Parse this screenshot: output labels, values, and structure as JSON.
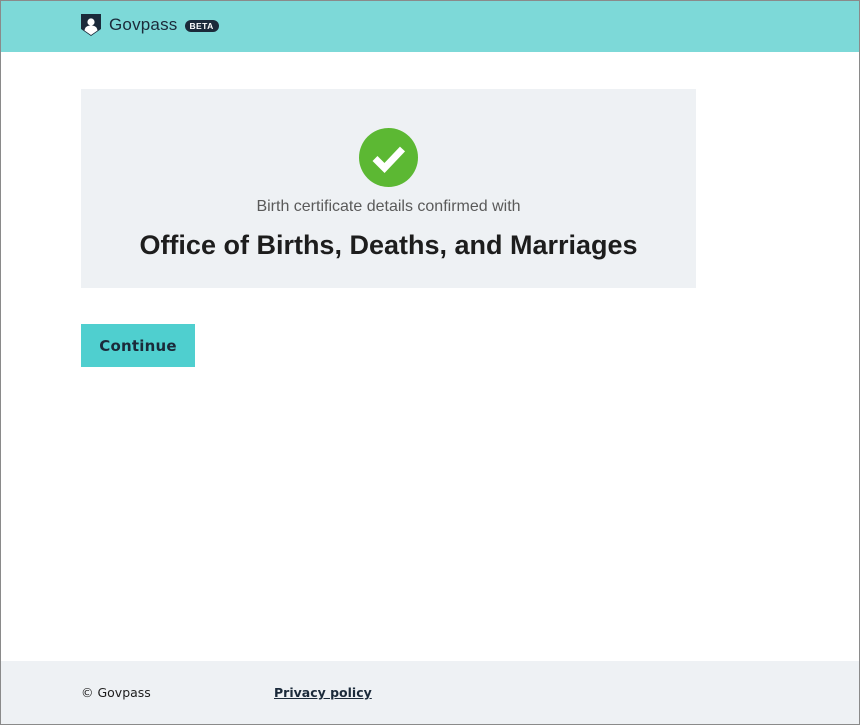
{
  "header": {
    "brand_name": "Govpass",
    "badge": "BETA",
    "logo_icon": "shield-person-icon",
    "background": "#7dd9d8"
  },
  "confirmation": {
    "status_icon": "check-circle-icon",
    "status_color": "#5cb833",
    "subtitle": "Birth certificate details confirmed with",
    "title": "Office of Births, Deaths, and Marriages"
  },
  "actions": {
    "continue_label": "Continue",
    "button_color": "#4fcfcf"
  },
  "footer": {
    "copyright": "© Govpass",
    "privacy_label": "Privacy policy"
  }
}
